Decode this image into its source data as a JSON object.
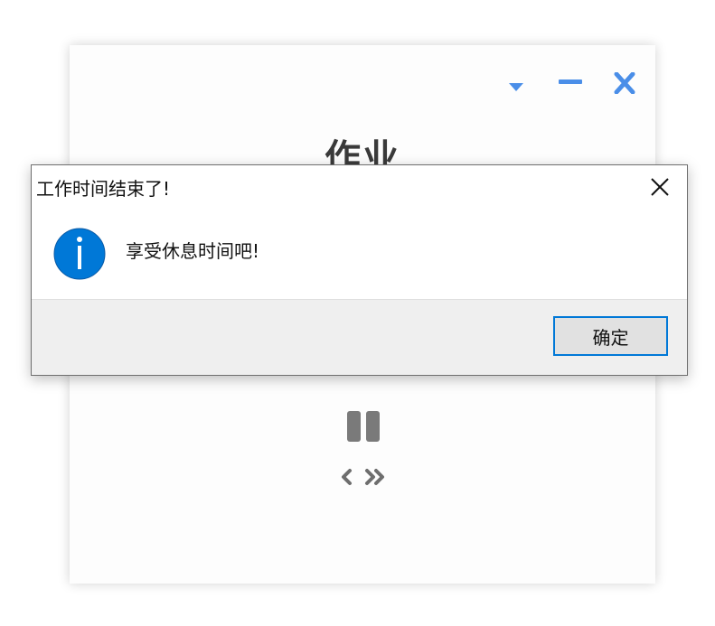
{
  "app": {
    "title": "作业",
    "controls": {
      "collapse_icon": "caret-down-icon",
      "minimize_icon": "minimize-icon",
      "close_icon": "close-icon"
    },
    "playback": {
      "pause_icon": "pause-icon",
      "prev_icon": "chevron-left-icon",
      "skip_icon": "double-chevron-right-icon"
    },
    "colors": {
      "accent": "#4a8ee8",
      "control_gray": "#6e6e6e"
    }
  },
  "dialog": {
    "title": "工作时间结束了!",
    "message": "享受休息时间吧!",
    "icon": "info-icon",
    "ok_label": "确定",
    "colors": {
      "info": "#0078d7",
      "button_border": "#0078d7"
    }
  }
}
